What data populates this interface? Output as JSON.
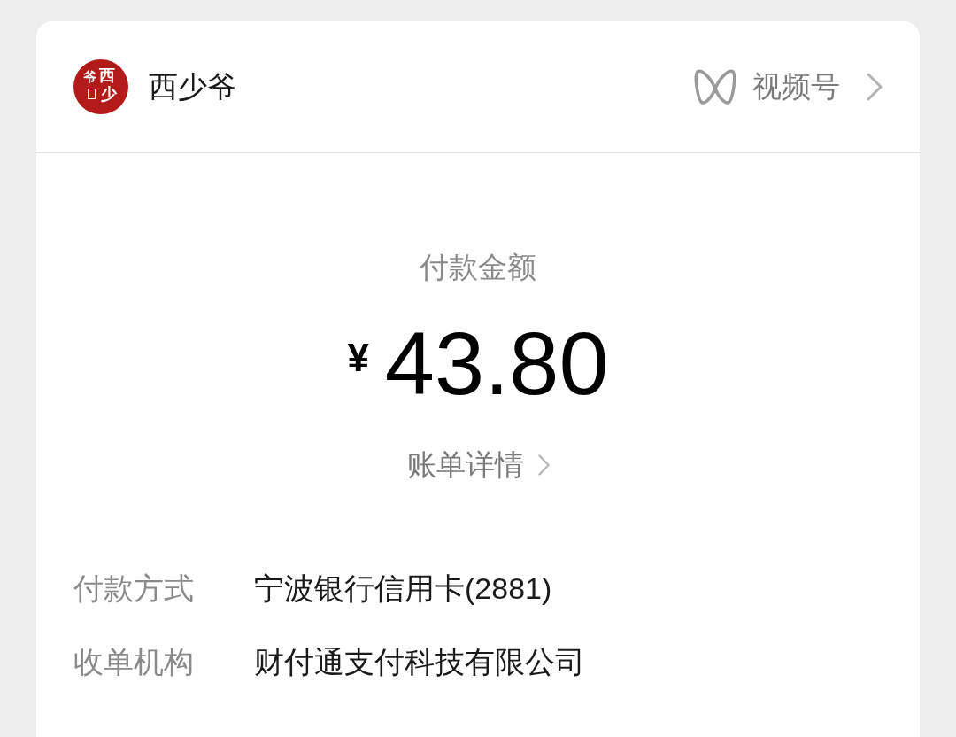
{
  "merchant": {
    "logo_glyphs": [
      "爷",
      "西",
      "少"
    ],
    "name": "西少爷"
  },
  "channel_link": {
    "label": "视频号"
  },
  "payment": {
    "label": "付款金额",
    "currency": "¥",
    "amount": "43.80"
  },
  "details_link": {
    "label": "账单详情"
  },
  "info_rows": [
    {
      "label": "付款方式",
      "value": "宁波银行信用卡(2881)"
    },
    {
      "label": "收单机构",
      "value": "财付通支付科技有限公司"
    }
  ]
}
